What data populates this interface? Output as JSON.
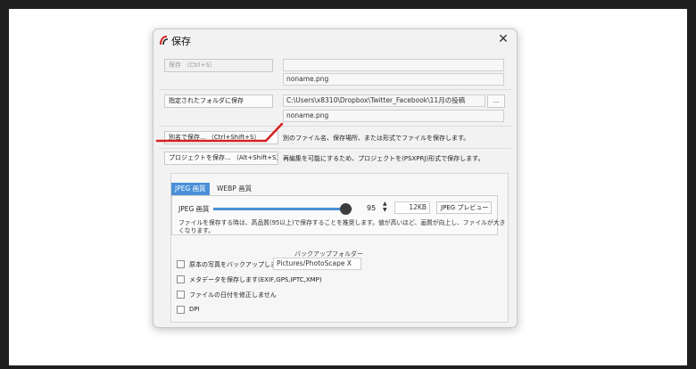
{
  "dialog": {
    "title": "保存",
    "close_glyph": "✕"
  },
  "save": {
    "button_label": "保存 （Ctrl+S）",
    "path_value": "",
    "filename": "noname.png"
  },
  "save_to_folder": {
    "button_label": "指定されたフォルダに保存",
    "path_value": "C:\\Users\\x8310\\Dropbox\\Twitter_Facebook\\11月の投稿",
    "browse_label": "...",
    "filename": "noname.png"
  },
  "save_as": {
    "button_label": "別名で保存... （Ctrl+Shift+S）",
    "description": "別のファイル名、保存場所、または形式でファイルを保存します。"
  },
  "save_project": {
    "button_label": "プロジェクトを保存... （Alt+Shift+S）",
    "description": "再編集を可能にするため、プロジェクトを(PSXPRJ)形式で保存します。"
  },
  "quality": {
    "tabs": [
      "JPEG 画質",
      "WEBP 画質"
    ],
    "jpeg_label": "JPEG 画質",
    "slider_fraction": 0.95,
    "value": "95",
    "size": "12KB",
    "preview_label": "JPEG プレビュー",
    "help_text_line1": "ファイルを保存する時は、高品質(95以上)で保存することを推奨します。値が高いほど、画質が向上し、ファイルが大き",
    "help_text_line2": "くなります。"
  },
  "backup": {
    "group_label": "バックアップフォルダー",
    "backup_label": "原本の写真をバックアップします",
    "backup_folder": "Pictures/PhotoScape X",
    "exif_label": "メタデータを保存します(EXIF,GPS,IPTC,XMP)",
    "date_label": "ファイルの日付を修正しません",
    "dpi_label": "DPI"
  },
  "colors": {
    "accent": "#4a90d9",
    "annotation": "#d42020"
  }
}
